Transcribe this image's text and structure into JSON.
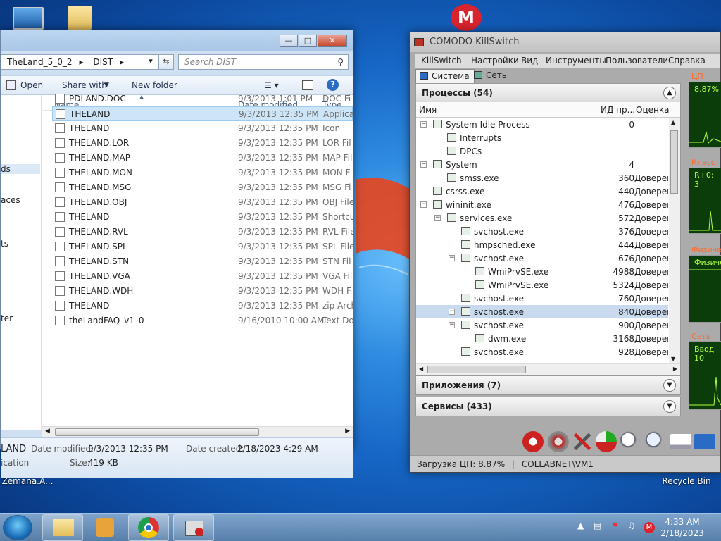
{
  "desktop": {
    "icons": [
      {
        "label": "Zemana.A...",
        "icon": "installer-icon"
      },
      {
        "label": "Recycle Bin",
        "icon": "recycle-bin-icon"
      }
    ]
  },
  "explorer": {
    "breadcrumb": [
      "TheLand_5_0_2",
      "DIST"
    ],
    "search_placeholder": "Search DIST",
    "toolbar": {
      "open": "Open",
      "share_with": "Share with",
      "new_folder": "New folder"
    },
    "nav_items": [
      "ds",
      "aces",
      "ts",
      "ter"
    ],
    "columns": {
      "name": "Name",
      "date_modified": "Date modified",
      "type": "Type"
    },
    "files": [
      {
        "name": "PDLAND.DOC",
        "date": "9/3/2013 1:01 PM",
        "type": "DOC Fi"
      },
      {
        "name": "THELAND",
        "date": "9/3/2013 12:35 PM",
        "type": "Applica"
      },
      {
        "name": "THELAND",
        "date": "9/3/2013 12:35 PM",
        "type": "Icon"
      },
      {
        "name": "THELAND.LOR",
        "date": "9/3/2013 12:35 PM",
        "type": "LOR Fil"
      },
      {
        "name": "THELAND.MAP",
        "date": "9/3/2013 12:35 PM",
        "type": "MAP Fil"
      },
      {
        "name": "THELAND.MON",
        "date": "9/3/2013 12:35 PM",
        "type": "MON F"
      },
      {
        "name": "THELAND.MSG",
        "date": "9/3/2013 12:35 PM",
        "type": "MSG Fi"
      },
      {
        "name": "THELAND.OBJ",
        "date": "9/3/2013 12:35 PM",
        "type": "OBJ File"
      },
      {
        "name": "THELAND",
        "date": "9/3/2013 12:35 PM",
        "type": "Shortcu"
      },
      {
        "name": "THELAND.RVL",
        "date": "9/3/2013 12:35 PM",
        "type": "RVL File"
      },
      {
        "name": "THELAND.SPL",
        "date": "9/3/2013 12:35 PM",
        "type": "SPL File"
      },
      {
        "name": "THELAND.STN",
        "date": "9/3/2013 12:35 PM",
        "type": "STN Fil"
      },
      {
        "name": "THELAND.VGA",
        "date": "9/3/2013 12:35 PM",
        "type": "VGA Fil"
      },
      {
        "name": "THELAND.WDH",
        "date": "9/3/2013 12:35 PM",
        "type": "WDH F"
      },
      {
        "name": "THELAND",
        "date": "9/3/2013 12:35 PM",
        "type": "zip Arch"
      },
      {
        "name": "theLandFAQ_v1_0",
        "date": "9/16/2010 10:00 AM",
        "type": "Text Do"
      }
    ],
    "details": {
      "name": "LAND",
      "kind": "ication",
      "date_modified_label": "Date modified:",
      "date_modified": "9/3/2013 12:35 PM",
      "date_created_label": "Date created:",
      "date_created": "2/18/2023 4:29 AM",
      "size_label": "Size:",
      "size": "419 KB"
    }
  },
  "killswitch": {
    "title": "COMODO KillSwitch",
    "menu": [
      "KillSwitch",
      "Настройки",
      "Вид",
      "Инструменты",
      "Пользователи",
      "Справка"
    ],
    "tabs": [
      "Система",
      "Сеть"
    ],
    "processes_header": "Процессы (54)",
    "columns": {
      "name": "Имя",
      "pid": "ИД пр...",
      "rating": "Оценка"
    },
    "processes": [
      {
        "name": "System Idle Process",
        "pid": "0",
        "rating": ""
      },
      {
        "name": "Interrupts",
        "pid": "",
        "rating": ""
      },
      {
        "name": "DPCs",
        "pid": "",
        "rating": ""
      },
      {
        "name": "System",
        "pid": "4",
        "rating": ""
      },
      {
        "name": "smss.exe",
        "pid": "360",
        "rating": "Доверен"
      },
      {
        "name": "csrss.exe",
        "pid": "440",
        "rating": "Доверен"
      },
      {
        "name": "wininit.exe",
        "pid": "476",
        "rating": "Доверен"
      },
      {
        "name": "services.exe",
        "pid": "572",
        "rating": "Доверен"
      },
      {
        "name": "svchost.exe",
        "pid": "376",
        "rating": "Доверен"
      },
      {
        "name": "hmpsched.exe",
        "pid": "444",
        "rating": "Доверен"
      },
      {
        "name": "svchost.exe",
        "pid": "676",
        "rating": "Доверен"
      },
      {
        "name": "WmiPrvSE.exe",
        "pid": "4988",
        "rating": "Доверен"
      },
      {
        "name": "WmiPrvSE.exe",
        "pid": "5324",
        "rating": "Доверен"
      },
      {
        "name": "svchost.exe",
        "pid": "760",
        "rating": "Доверен"
      },
      {
        "name": "svchost.exe",
        "pid": "840",
        "rating": "Доверен"
      },
      {
        "name": "svchost.exe",
        "pid": "900",
        "rating": "Доверен"
      },
      {
        "name": "dwm.exe",
        "pid": "3168",
        "rating": "Доверен"
      },
      {
        "name": "svchost.exe",
        "pid": "928",
        "rating": "Доверен"
      }
    ],
    "apps_header": "Приложения (7)",
    "services_header": "Сервисы (433)",
    "graphs": [
      {
        "label": "ЦП",
        "value": "8.87%"
      },
      {
        "label": "Класс В",
        "value": "R+0: 3"
      },
      {
        "label": "Физиче",
        "value": "Физиче"
      },
      {
        "label": "Сеть",
        "value": "Ввод 10"
      }
    ],
    "status": {
      "cpu": "Загрузка ЦП: 8.87%",
      "user": "COLLABNET\\VM1"
    }
  },
  "taskbar": {
    "clock_time": "4:33 AM",
    "clock_date": "2/18/2023"
  },
  "colors": {
    "desktop_blue": "#1666c5",
    "selection": "#cde6f7",
    "graph_bg": "#0a3d0a",
    "graph_line": "#b0ff40"
  }
}
